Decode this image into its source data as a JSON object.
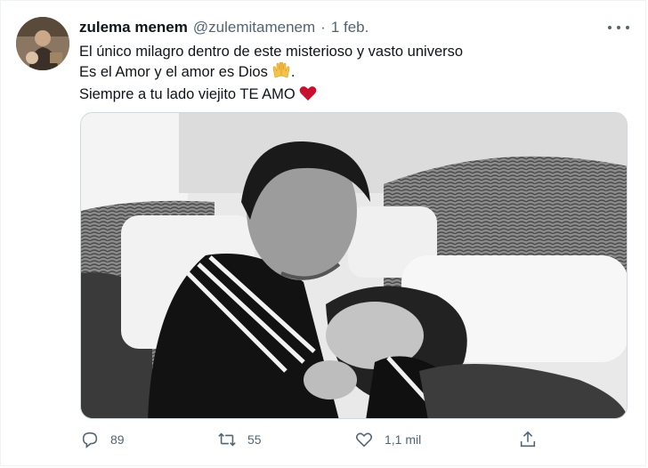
{
  "tweet": {
    "author_name": "zulema menem",
    "handle": "@zulemitamenem",
    "separator": "·",
    "date": "1 feb.",
    "lines": [
      "El único milagro dentro de este misterioso y vasto universo",
      "Es el Amor y el amor es Dios",
      "Siempre a tu lado viejito TE AMO"
    ],
    "emoji": {
      "praying_hands_icon": "raising-hands-icon",
      "heart_icon": "red-heart-icon"
    },
    "media": {
      "kind": "photo",
      "style": "black-and-white"
    }
  },
  "actions": {
    "reply_count": "89",
    "retweet_count": "55",
    "like_count": "1,1 mil",
    "share_icon": "share-icon"
  },
  "colors": {
    "text_primary": "#0f1419",
    "text_secondary": "#536471",
    "heart": "#c8102e",
    "border": "#cfd9de"
  }
}
